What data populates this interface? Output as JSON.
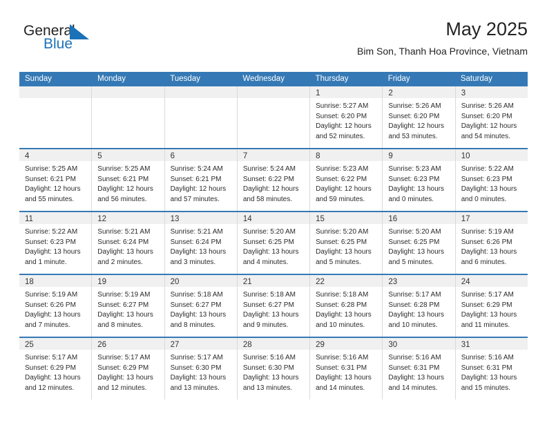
{
  "brand": {
    "name_top": "General",
    "name_bottom": "Blue",
    "triangle_icon": "blue-triangle-icon",
    "accent_color": "#1b72b8"
  },
  "header": {
    "title": "May 2025",
    "subtitle": "Bim Son, Thanh Hoa Province, Vietnam"
  },
  "theme": {
    "header_row_bg": "#3479b5",
    "daynum_band_bg": "#f0f0f0",
    "grid_line": "#d9d9d9",
    "text": "#2a2a2a"
  },
  "weekdays": [
    "Sunday",
    "Monday",
    "Tuesday",
    "Wednesday",
    "Thursday",
    "Friday",
    "Saturday"
  ],
  "chart_data": {
    "type": "table",
    "title": "May 2025",
    "subtitle": "Bim Son, Thanh Hoa Province, Vietnam",
    "columns": [
      "Sunday",
      "Monday",
      "Tuesday",
      "Wednesday",
      "Thursday",
      "Friday",
      "Saturday"
    ],
    "days": [
      {
        "day": 1,
        "sunrise": "5:27 AM",
        "sunset": "6:20 PM",
        "daylight_hours": 12,
        "daylight_minutes": 52
      },
      {
        "day": 2,
        "sunrise": "5:26 AM",
        "sunset": "6:20 PM",
        "daylight_hours": 12,
        "daylight_minutes": 53
      },
      {
        "day": 3,
        "sunrise": "5:26 AM",
        "sunset": "6:20 PM",
        "daylight_hours": 12,
        "daylight_minutes": 54
      },
      {
        "day": 4,
        "sunrise": "5:25 AM",
        "sunset": "6:21 PM",
        "daylight_hours": 12,
        "daylight_minutes": 55
      },
      {
        "day": 5,
        "sunrise": "5:25 AM",
        "sunset": "6:21 PM",
        "daylight_hours": 12,
        "daylight_minutes": 56
      },
      {
        "day": 6,
        "sunrise": "5:24 AM",
        "sunset": "6:21 PM",
        "daylight_hours": 12,
        "daylight_minutes": 57
      },
      {
        "day": 7,
        "sunrise": "5:24 AM",
        "sunset": "6:22 PM",
        "daylight_hours": 12,
        "daylight_minutes": 58
      },
      {
        "day": 8,
        "sunrise": "5:23 AM",
        "sunset": "6:22 PM",
        "daylight_hours": 12,
        "daylight_minutes": 59
      },
      {
        "day": 9,
        "sunrise": "5:23 AM",
        "sunset": "6:23 PM",
        "daylight_hours": 13,
        "daylight_minutes": 0
      },
      {
        "day": 10,
        "sunrise": "5:22 AM",
        "sunset": "6:23 PM",
        "daylight_hours": 13,
        "daylight_minutes": 0
      },
      {
        "day": 11,
        "sunrise": "5:22 AM",
        "sunset": "6:23 PM",
        "daylight_hours": 13,
        "daylight_minutes": 1
      },
      {
        "day": 12,
        "sunrise": "5:21 AM",
        "sunset": "6:24 PM",
        "daylight_hours": 13,
        "daylight_minutes": 2
      },
      {
        "day": 13,
        "sunrise": "5:21 AM",
        "sunset": "6:24 PM",
        "daylight_hours": 13,
        "daylight_minutes": 3
      },
      {
        "day": 14,
        "sunrise": "5:20 AM",
        "sunset": "6:25 PM",
        "daylight_hours": 13,
        "daylight_minutes": 4
      },
      {
        "day": 15,
        "sunrise": "5:20 AM",
        "sunset": "6:25 PM",
        "daylight_hours": 13,
        "daylight_minutes": 5
      },
      {
        "day": 16,
        "sunrise": "5:20 AM",
        "sunset": "6:25 PM",
        "daylight_hours": 13,
        "daylight_minutes": 5
      },
      {
        "day": 17,
        "sunrise": "5:19 AM",
        "sunset": "6:26 PM",
        "daylight_hours": 13,
        "daylight_minutes": 6
      },
      {
        "day": 18,
        "sunrise": "5:19 AM",
        "sunset": "6:26 PM",
        "daylight_hours": 13,
        "daylight_minutes": 7
      },
      {
        "day": 19,
        "sunrise": "5:19 AM",
        "sunset": "6:27 PM",
        "daylight_hours": 13,
        "daylight_minutes": 8
      },
      {
        "day": 20,
        "sunrise": "5:18 AM",
        "sunset": "6:27 PM",
        "daylight_hours": 13,
        "daylight_minutes": 8
      },
      {
        "day": 21,
        "sunrise": "5:18 AM",
        "sunset": "6:27 PM",
        "daylight_hours": 13,
        "daylight_minutes": 9
      },
      {
        "day": 22,
        "sunrise": "5:18 AM",
        "sunset": "6:28 PM",
        "daylight_hours": 13,
        "daylight_minutes": 10
      },
      {
        "day": 23,
        "sunrise": "5:17 AM",
        "sunset": "6:28 PM",
        "daylight_hours": 13,
        "daylight_minutes": 10
      },
      {
        "day": 24,
        "sunrise": "5:17 AM",
        "sunset": "6:29 PM",
        "daylight_hours": 13,
        "daylight_minutes": 11
      },
      {
        "day": 25,
        "sunrise": "5:17 AM",
        "sunset": "6:29 PM",
        "daylight_hours": 13,
        "daylight_minutes": 12
      },
      {
        "day": 26,
        "sunrise": "5:17 AM",
        "sunset": "6:29 PM",
        "daylight_hours": 13,
        "daylight_minutes": 12
      },
      {
        "day": 27,
        "sunrise": "5:17 AM",
        "sunset": "6:30 PM",
        "daylight_hours": 13,
        "daylight_minutes": 13
      },
      {
        "day": 28,
        "sunrise": "5:16 AM",
        "sunset": "6:30 PM",
        "daylight_hours": 13,
        "daylight_minutes": 13
      },
      {
        "day": 29,
        "sunrise": "5:16 AM",
        "sunset": "6:31 PM",
        "daylight_hours": 13,
        "daylight_minutes": 14
      },
      {
        "day": 30,
        "sunrise": "5:16 AM",
        "sunset": "6:31 PM",
        "daylight_hours": 13,
        "daylight_minutes": 14
      },
      {
        "day": 31,
        "sunrise": "5:16 AM",
        "sunset": "6:31 PM",
        "daylight_hours": 13,
        "daylight_minutes": 15
      }
    ],
    "leading_blanks": 4,
    "labels": {
      "sunrise_prefix": "Sunrise:",
      "sunset_prefix": "Sunset:",
      "daylight_prefix": "Daylight:",
      "hours_word": "hours",
      "hour_word": "hour",
      "and_word": "and",
      "minutes_word": "minutes.",
      "minute_word": "minute."
    }
  },
  "weeks": [
    [
      null,
      null,
      null,
      null,
      1,
      2,
      3
    ],
    [
      4,
      5,
      6,
      7,
      8,
      9,
      10
    ],
    [
      11,
      12,
      13,
      14,
      15,
      16,
      17
    ],
    [
      18,
      19,
      20,
      21,
      22,
      23,
      24
    ],
    [
      25,
      26,
      27,
      28,
      29,
      30,
      31
    ]
  ]
}
